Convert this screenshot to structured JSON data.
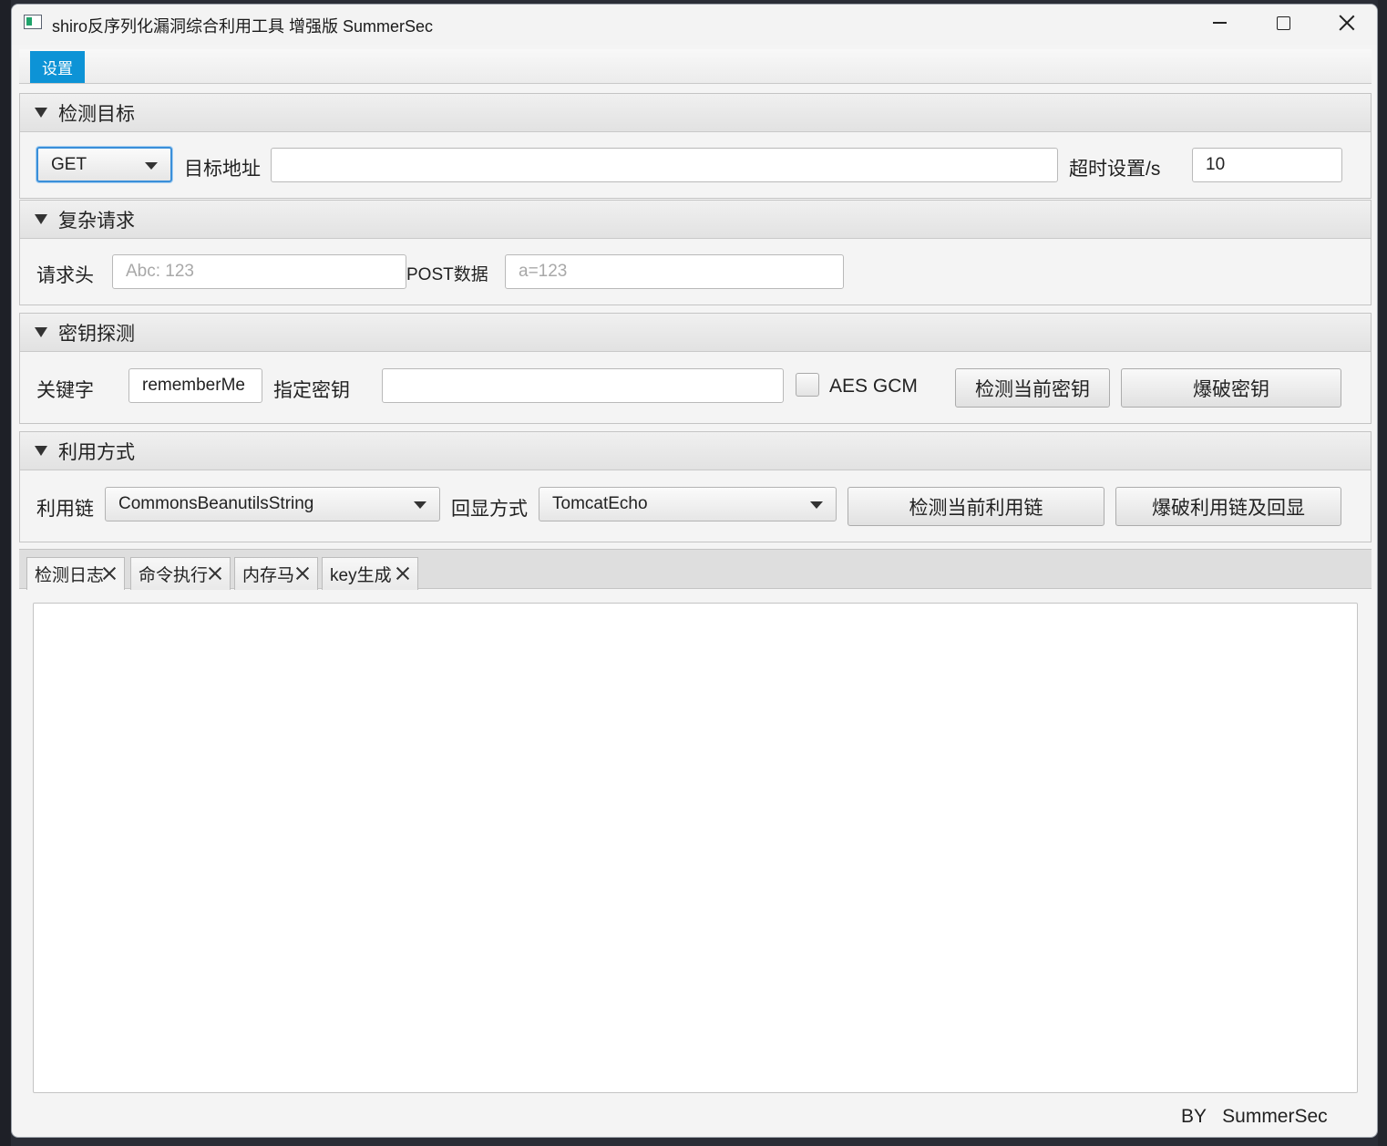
{
  "window": {
    "title": "shiro反序列化漏洞综合利用工具 增强版 SummerSec"
  },
  "menubar": {
    "items": [
      {
        "label": "设置"
      }
    ]
  },
  "detect_target": {
    "title": "检测目标",
    "method": "GET",
    "url_label": "目标地址",
    "url_value": "",
    "timeout_label": "超时设置/s",
    "timeout_value": "10"
  },
  "complex_request": {
    "title": "复杂请求",
    "header_label": "请求头",
    "header_placeholder": "Abc: 123",
    "post_label": "POST数据",
    "post_placeholder": "a=123"
  },
  "key_detect": {
    "title": "密钥探测",
    "keyword_label": "关键字",
    "keyword_value": "rememberMe",
    "specify_key_label": "指定密钥",
    "specify_key_value": "",
    "aes_gcm_label": "AES GCM",
    "aes_gcm_checked": false,
    "check_key_button": "检测当前密钥",
    "brute_key_button": "爆破密钥"
  },
  "exploit": {
    "title": "利用方式",
    "chain_label": "利用链",
    "chain_value": "CommonsBeanutilsString",
    "echo_label": "回显方式",
    "echo_value": "TomcatEcho",
    "check_chain_button": "检测当前利用链",
    "brute_chain_button": "爆破利用链及回显"
  },
  "tabs": [
    {
      "label": "检测日志"
    },
    {
      "label": "命令执行"
    },
    {
      "label": "内存马"
    },
    {
      "label": "key生成"
    }
  ],
  "log_content": "",
  "footer": {
    "text": "BY   SummerSec"
  },
  "colors": {
    "accent": "#0d93d6",
    "focus_border": "#3a8fd9"
  }
}
